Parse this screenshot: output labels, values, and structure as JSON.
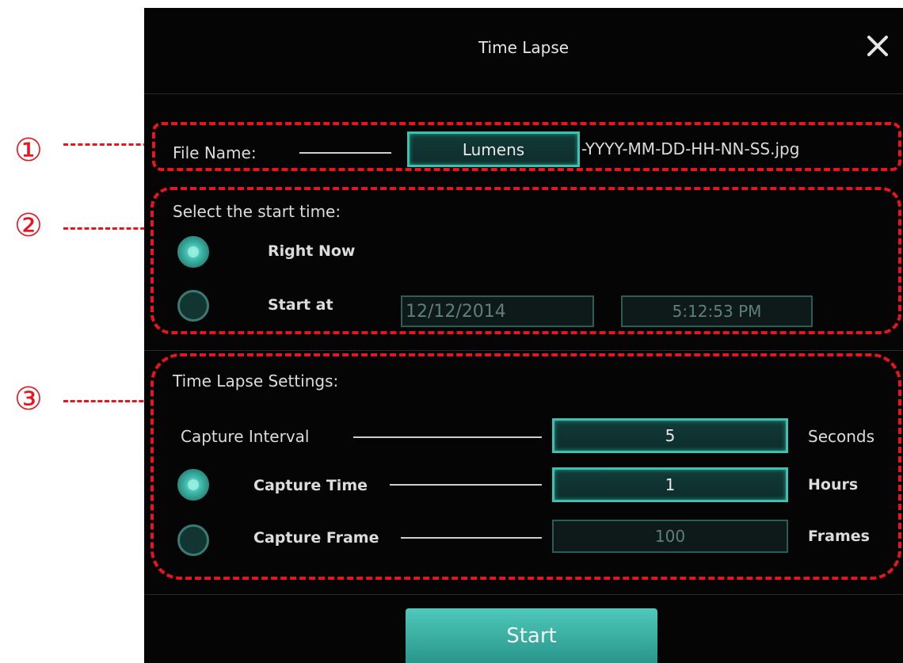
{
  "dialog": {
    "title": "Time Lapse",
    "close_icon": "close-icon"
  },
  "file_name": {
    "label": "File Name:",
    "value": "Lumens",
    "suffix": "-YYYY-MM-DD-HH-NN-SS.jpg"
  },
  "start_time": {
    "heading": "Select the start time:",
    "right_now_label": "Right Now",
    "start_at_label": "Start at",
    "date": "12/12/2014",
    "time": "5:12:53 PM",
    "selected": "Right Now"
  },
  "settings": {
    "heading": "Time Lapse Settings:",
    "capture_interval_label": "Capture Interval",
    "capture_interval_value": "5",
    "capture_interval_unit": "Seconds",
    "capture_time_label": "Capture Time",
    "capture_time_value": "1",
    "capture_time_unit": "Hours",
    "capture_frame_label": "Capture Frame",
    "capture_frame_value": "100",
    "capture_frame_unit": "Frames",
    "selected": "Capture Time"
  },
  "start_button": "Start",
  "annotations": {
    "one": "①",
    "two": "②",
    "three": "③"
  },
  "colors": {
    "accent": "#3fbfae",
    "annotation": "#e8141e",
    "background": "#050505"
  }
}
